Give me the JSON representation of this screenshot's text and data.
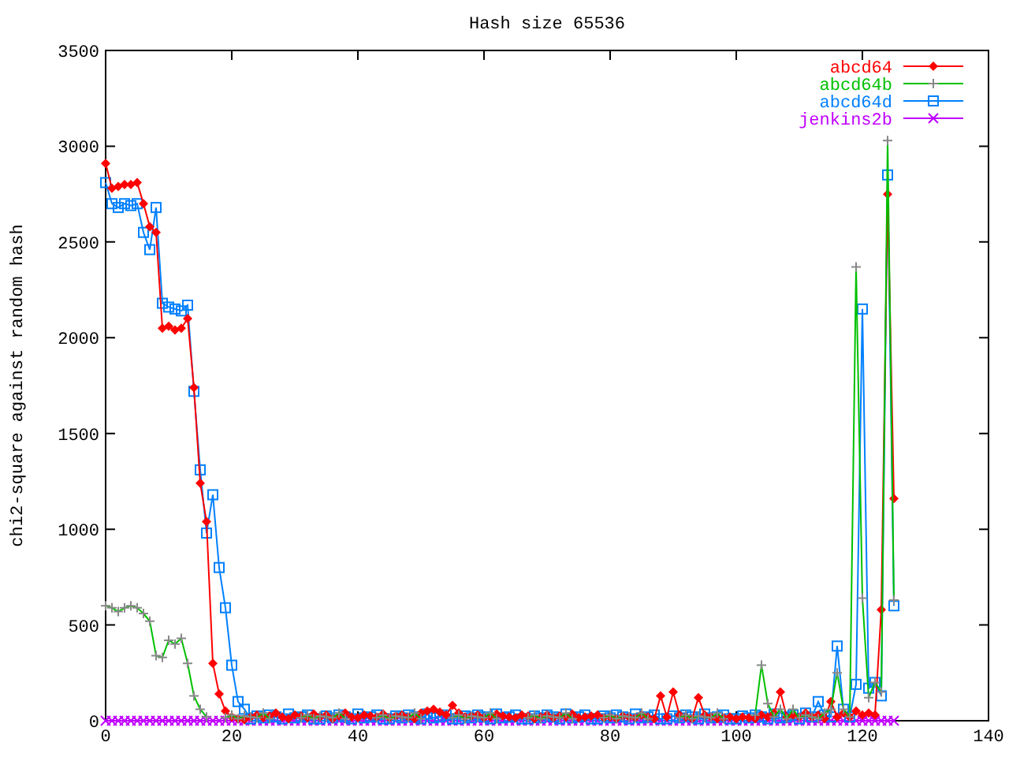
{
  "chart_data": {
    "type": "line",
    "title": "Hash size 65536",
    "ylabel": "chi2-square against random hash",
    "x": [
      0,
      1,
      2,
      3,
      4,
      5,
      6,
      7,
      8,
      9,
      10,
      11,
      12,
      13,
      14,
      15,
      16,
      17,
      18,
      19,
      20,
      21,
      22,
      23,
      24,
      25,
      26,
      27,
      28,
      29,
      30,
      31,
      32,
      33,
      34,
      35,
      36,
      37,
      38,
      39,
      40,
      41,
      42,
      43,
      44,
      45,
      46,
      47,
      48,
      49,
      50,
      51,
      52,
      53,
      54,
      55,
      56,
      57,
      58,
      59,
      60,
      61,
      62,
      63,
      64,
      65,
      66,
      67,
      68,
      69,
      70,
      71,
      72,
      73,
      74,
      75,
      76,
      77,
      78,
      79,
      80,
      81,
      82,
      83,
      84,
      85,
      86,
      87,
      88,
      89,
      90,
      91,
      92,
      93,
      94,
      95,
      96,
      97,
      98,
      99,
      100,
      101,
      102,
      103,
      104,
      105,
      106,
      107,
      108,
      109,
      110,
      111,
      112,
      113,
      114,
      115,
      116,
      117,
      118,
      119,
      120,
      121,
      122,
      123,
      124,
      125
    ],
    "series": [
      {
        "name": "abcd64",
        "color": "#ff0000",
        "marker": "diamond",
        "values": [
          2910,
          2780,
          2790,
          2800,
          2800,
          2810,
          2700,
          2580,
          2550,
          2050,
          2060,
          2040,
          2050,
          2100,
          1740,
          1240,
          1040,
          300,
          140,
          50,
          20,
          10,
          5,
          20,
          30,
          15,
          25,
          40,
          20,
          10,
          30,
          25,
          15,
          35,
          20,
          30,
          10,
          25,
          40,
          20,
          15,
          30,
          25,
          20,
          35,
          15,
          25,
          30,
          20,
          10,
          40,
          50,
          60,
          45,
          30,
          80,
          40,
          20,
          25,
          30,
          15,
          20,
          35,
          25,
          20,
          15,
          30,
          25,
          10,
          20,
          30,
          15,
          25,
          20,
          35,
          15,
          20,
          25,
          30,
          15,
          20,
          10,
          25,
          20,
          15,
          30,
          20,
          10,
          130,
          20,
          150,
          30,
          20,
          10,
          120,
          30,
          20,
          10,
          15,
          20,
          10,
          20,
          15,
          10,
          30,
          20,
          40,
          150,
          20,
          30,
          20,
          40,
          20,
          30,
          10,
          100,
          20,
          40,
          20,
          50,
          30,
          40,
          30,
          580,
          2750,
          1160
        ]
      },
      {
        "name": "abcd64b",
        "color": "#00c000",
        "values": [
          600,
          590,
          570,
          590,
          600,
          590,
          560,
          520,
          340,
          330,
          420,
          400,
          430,
          300,
          130,
          60,
          20,
          null,
          null,
          15,
          30,
          10,
          25,
          20,
          15,
          40,
          10,
          null,
          null,
          null,
          null,
          15,
          30,
          10,
          25,
          20,
          15,
          40,
          10,
          null,
          null,
          null,
          null,
          15,
          30,
          10,
          25,
          20,
          15,
          40,
          10,
          null,
          null,
          null,
          null,
          15,
          30,
          10,
          25,
          20,
          15,
          40,
          10,
          null,
          null,
          null,
          null,
          15,
          30,
          10,
          25,
          20,
          15,
          40,
          10,
          null,
          null,
          null,
          null,
          15,
          30,
          10,
          25,
          20,
          15,
          40,
          10,
          null,
          null,
          null,
          null,
          15,
          30,
          10,
          25,
          20,
          15,
          40,
          10,
          null,
          null,
          null,
          null,
          30,
          290,
          90,
          20,
          60,
          10,
          60,
          15,
          30,
          20,
          10,
          40,
          60,
          250,
          60,
          20,
          2370,
          640,
          120,
          200,
          150,
          3030,
          630
        ]
      },
      {
        "name": "abcd64d",
        "color": "#0080ff",
        "marker": "square",
        "values": [
          2810,
          2700,
          2680,
          2700,
          2690,
          2700,
          2550,
          2460,
          2680,
          2180,
          2160,
          2150,
          2140,
          2170,
          1720,
          1310,
          980,
          1180,
          800,
          590,
          290,
          100,
          60,
          10,
          25,
          15,
          30,
          20,
          10,
          35,
          15,
          20,
          30,
          10,
          10,
          25,
          15,
          30,
          20,
          10,
          35,
          15,
          20,
          30,
          10,
          10,
          25,
          15,
          30,
          20,
          10,
          35,
          15,
          20,
          30,
          10,
          10,
          25,
          15,
          30,
          20,
          10,
          35,
          15,
          20,
          30,
          10,
          10,
          25,
          15,
          30,
          20,
          10,
          35,
          15,
          20,
          30,
          10,
          10,
          25,
          15,
          30,
          20,
          10,
          35,
          15,
          20,
          30,
          10,
          10,
          25,
          15,
          30,
          20,
          10,
          35,
          15,
          20,
          30,
          10,
          10,
          25,
          15,
          30,
          20,
          10,
          35,
          15,
          20,
          30,
          10,
          40,
          20,
          100,
          30,
          20,
          390,
          60,
          20,
          190,
          2150,
          170,
          200,
          130,
          2850,
          600
        ]
      },
      {
        "name": "jenkins2b",
        "color": "#c000ff",
        "marker": "cross",
        "values": [
          0,
          0,
          0,
          0,
          0,
          0,
          0,
          0,
          0,
          0,
          0,
          0,
          0,
          0,
          0,
          0,
          0,
          0,
          0,
          0,
          0,
          0,
          0,
          0,
          0,
          0,
          0,
          0,
          0,
          0,
          0,
          0,
          0,
          0,
          0,
          0,
          0,
          0,
          0,
          0,
          0,
          0,
          0,
          0,
          0,
          0,
          0,
          0,
          0,
          0,
          0,
          0,
          0,
          0,
          0,
          0,
          0,
          0,
          0,
          0,
          0,
          0,
          0,
          0,
          0,
          0,
          0,
          0,
          0,
          0,
          0,
          0,
          0,
          0,
          0,
          0,
          0,
          0,
          0,
          0,
          0,
          0,
          0,
          0,
          0,
          0,
          0,
          0,
          0,
          0,
          0,
          0,
          0,
          0,
          0,
          0,
          0,
          0,
          0,
          0,
          0,
          0,
          0,
          0,
          0,
          0,
          0,
          0,
          0,
          0,
          0,
          0,
          0,
          0,
          0,
          0,
          0,
          0,
          0,
          0,
          0,
          0,
          0,
          0,
          0,
          0
        ]
      }
    ],
    "legend": true,
    "xlim": [
      0,
      140
    ],
    "ylim": [
      0,
      3500
    ],
    "xticks": [
      0,
      20,
      40,
      60,
      80,
      100,
      120,
      140
    ],
    "yticks": [
      0,
      500,
      1000,
      1500,
      2000,
      2500,
      3000,
      3500
    ]
  }
}
